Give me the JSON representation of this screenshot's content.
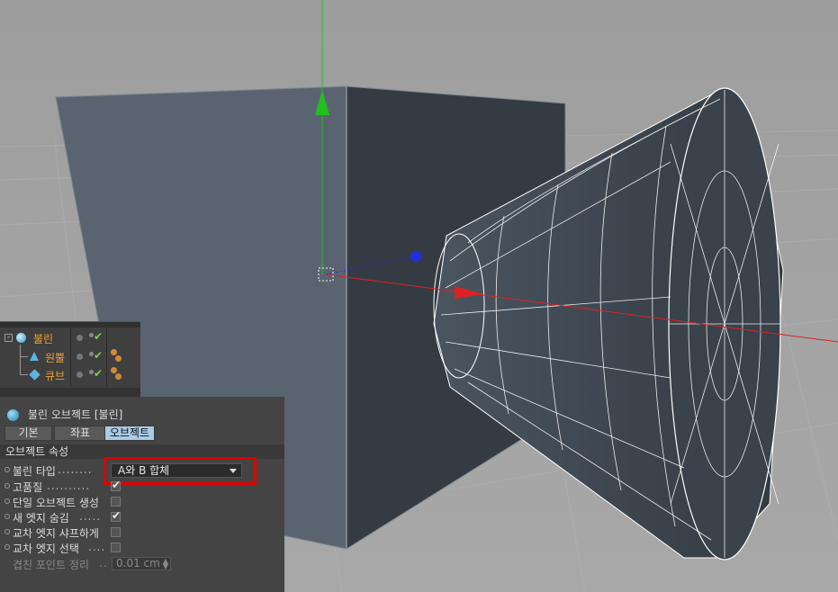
{
  "object_manager": {
    "objects": [
      {
        "name": "불린",
        "icon": "boole-icon",
        "level": 0
      },
      {
        "name": "원뿔",
        "icon": "cone-icon",
        "level": 1
      },
      {
        "name": "큐브",
        "icon": "cube-icon",
        "level": 1
      }
    ]
  },
  "attribute_manager": {
    "title": "불린 오브젝트 [불린]",
    "tabs": [
      {
        "label": "기본",
        "active": false
      },
      {
        "label": "좌표",
        "active": false
      },
      {
        "label": "오브젝트",
        "active": true
      }
    ],
    "section_title": "오브젝트 속성",
    "properties": {
      "boole_type": {
        "label": "불린 타입",
        "dots": "........",
        "value": "A와 B 합체"
      },
      "high_quality": {
        "label": "고품질",
        "dots": "..........",
        "checked": true
      },
      "single_object": {
        "label": "단일 오브젝트 생성",
        "checked": false
      },
      "hide_new_edges": {
        "label": "새 엣지 숨김",
        "dots": ".....",
        "checked": true
      },
      "sharpen_intersection": {
        "label": "교차 엣지 샤프하게",
        "checked": false
      },
      "select_intersection": {
        "label": "교차 엣지 선택",
        "dots": "....",
        "checked": false
      },
      "optimize_points": {
        "label": "겹친 포인트 정리",
        "dots": "..",
        "value": "0.01 cm",
        "enabled": false
      }
    }
  },
  "colors": {
    "viewport_bg": "#a2a2a2",
    "object_name": "#f0a030",
    "active_tab": "#a9cbe8",
    "highlight_box": "#e00000",
    "axis_x": "#e02020",
    "axis_y": "#20c020",
    "axis_z": "#2030e0"
  }
}
